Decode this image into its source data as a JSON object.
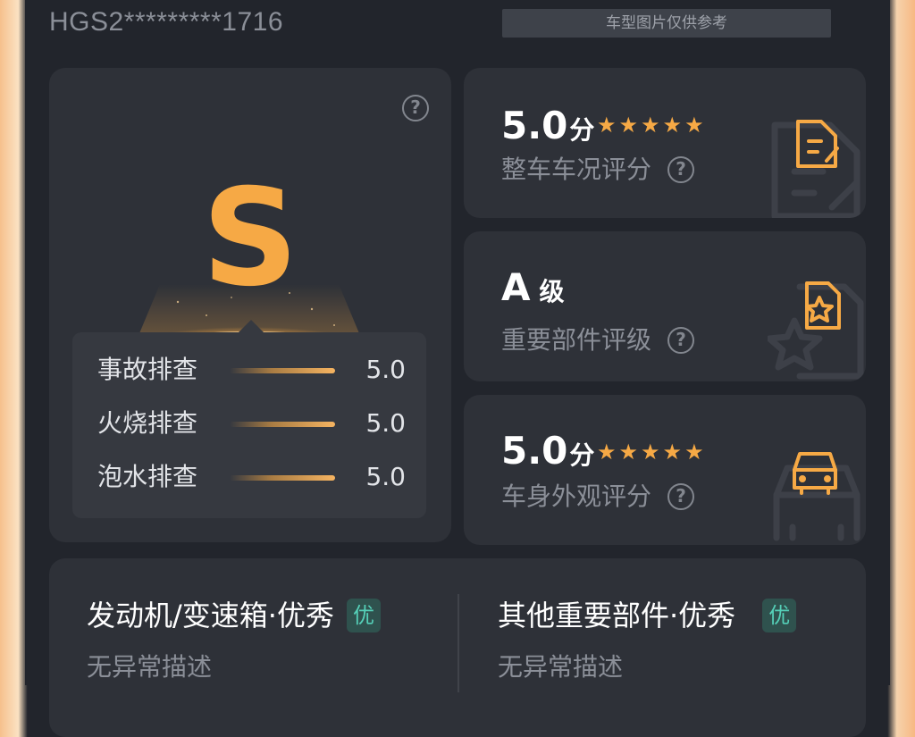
{
  "vehicle": {
    "vin_masked": "HGS2*********1716",
    "image_note": "车型图片仅供参考"
  },
  "grade": {
    "letter": "S",
    "checks": [
      {
        "label": "事故排查",
        "value": "5.0",
        "level": 1.0
      },
      {
        "label": "火烧排查",
        "value": "5.0",
        "level": 1.0
      },
      {
        "label": "泡水排查",
        "value": "5.0",
        "level": 1.0
      }
    ]
  },
  "scores": [
    {
      "value": "5.0",
      "unit": "分",
      "stars": 5,
      "label": "整车车况评分",
      "icon": "document-edit-icon"
    },
    {
      "value": "A",
      "unit": "级",
      "stars": 0,
      "label": "重要部件评级",
      "icon": "document-star-icon"
    },
    {
      "value": "5.0",
      "unit": "分",
      "stars": 5,
      "label": "车身外观评分",
      "icon": "car-front-icon"
    }
  ],
  "parts": [
    {
      "title": "发动机/变速箱·优秀",
      "badge": "优",
      "desc": "无异常描述"
    },
    {
      "title": "其他重要部件·优秀",
      "badge": "优",
      "desc": "无异常描述"
    }
  ],
  "colors": {
    "background": "#22252c",
    "card": "#2e3138",
    "accent": "#f6a945",
    "badge_text": "#55d0b8"
  }
}
